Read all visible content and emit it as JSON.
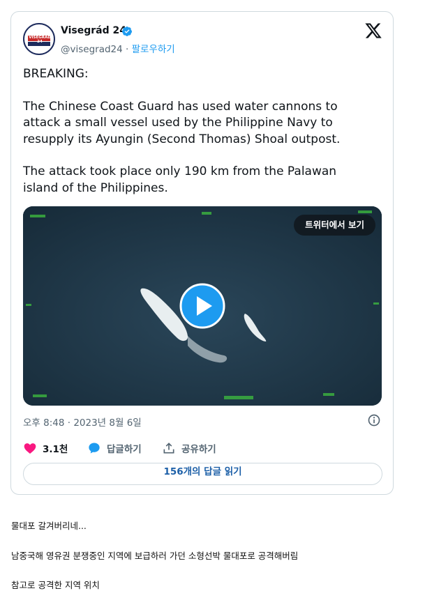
{
  "tweet": {
    "display_name": "Visegrád 24",
    "handle": "@visegrad24",
    "separator": "·",
    "follow_label": "팔로우하기",
    "avatar_text": "VISEGRAD 24",
    "paragraphs": [
      "BREAKING:",
      "The Chinese Coast Guard has used water cannons to attack a small vessel used by the Philippine Navy to resupply its Ayungin (Second Thomas) Shoal outpost.",
      "The attack took place only 190 km from the Palawan island of the Philippines."
    ],
    "media": {
      "watch_on_x_label": "트위터에서 보기",
      "play_icon": "play-icon"
    },
    "timestamp": "오후 8:48 · 2023년 8월 6일",
    "actions": {
      "like_count": "3.1천",
      "reply_label": "답글하기",
      "share_label": "공유하기"
    },
    "read_replies_label": "156개의 답글 읽기",
    "colors": {
      "link": "#1d9bf0",
      "like": "#f91880",
      "border": "#cfd9de"
    }
  },
  "post_body": {
    "lines": [
      "물대포 갈겨버리네...",
      "남중국해 영유권 분쟁중인 지역에 보급하러 가던 소형선박 물대포로 공격해버림",
      "참고로 공격한 지역 위치"
    ]
  }
}
